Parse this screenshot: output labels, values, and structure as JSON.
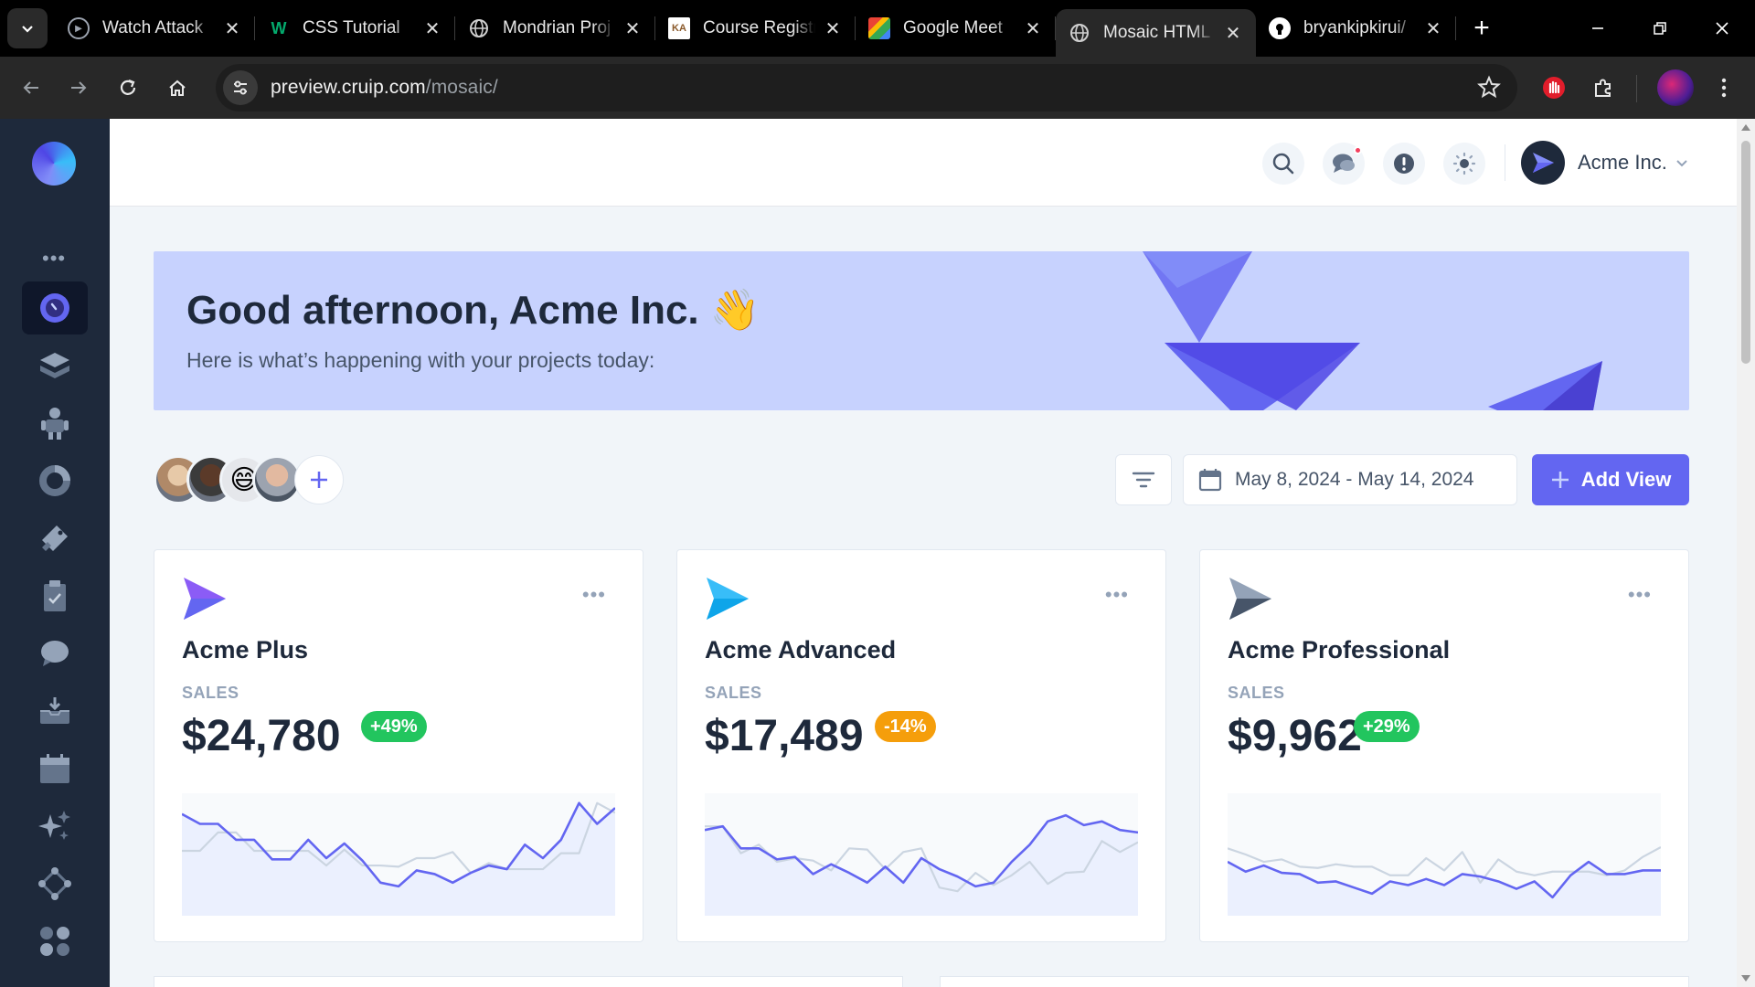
{
  "browser": {
    "tabs": [
      {
        "label": "Watch Attack",
        "icon": "play-circle-icon"
      },
      {
        "label": "CSS Tutorial",
        "icon": "w3schools-icon"
      },
      {
        "label": "Mondrian Proj",
        "icon": "globe-icon"
      },
      {
        "label": "Course Registr",
        "icon": "university-icon"
      },
      {
        "label": "Google Meet",
        "icon": "google-meet-icon"
      },
      {
        "label": "Mosaic HTML",
        "icon": "globe-icon",
        "active": true
      },
      {
        "label": "bryankipkirui/",
        "icon": "github-icon"
      }
    ],
    "url_host": "preview.cruip.com",
    "url_path": "/mosaic/"
  },
  "header": {
    "user_name": "Acme Inc."
  },
  "banner": {
    "title": "Good afternoon, Acme Inc. 👋",
    "subtitle": "Here is what’s happening with your projects today:"
  },
  "actions": {
    "date_range": "May 8, 2024 - May 14, 2024",
    "add_view_label": "Add View"
  },
  "cards": [
    {
      "title": "Acme Plus",
      "label": "SALES",
      "value": "$24,780",
      "badge": "+49%",
      "badge_color": "#22c55e",
      "logo_colors": [
        "#8b5cf6",
        "#6366f1"
      ]
    },
    {
      "title": "Acme Advanced",
      "label": "SALES",
      "value": "$17,489",
      "badge": "-14%",
      "badge_color": "#f59e0b",
      "logo_colors": [
        "#38bdf8",
        "#0ea5e9"
      ]
    },
    {
      "title": "Acme Professional",
      "label": "SALES",
      "value": "$9,962",
      "badge": "+29%",
      "badge_color": "#22c55e",
      "logo_colors": [
        "#94a3b8",
        "#475569"
      ]
    }
  ],
  "chart_data": [
    {
      "type": "line",
      "series": [
        {
          "values": [
            83,
            75,
            75,
            62,
            62,
            46,
            46,
            62,
            47,
            59,
            45,
            27,
            24,
            37,
            34,
            27,
            35,
            41,
            38,
            58,
            47,
            62,
            92,
            75,
            88
          ]
        },
        {
          "values": [
            53,
            53,
            68,
            68,
            53,
            53,
            53,
            53,
            41,
            54,
            41,
            41,
            40,
            47,
            47,
            52,
            35,
            43,
            38,
            38,
            38,
            51,
            51,
            92,
            84
          ]
        }
      ],
      "ylim": [
        0,
        100
      ]
    },
    {
      "type": "line",
      "series": [
        {
          "values": [
            70,
            73,
            55,
            55,
            46,
            48,
            34,
            42,
            35,
            27,
            40,
            27,
            47,
            38,
            32,
            24,
            27,
            44,
            58,
            77,
            82,
            74,
            77,
            70,
            68
          ]
        },
        {
          "values": [
            73,
            73,
            51,
            58,
            44,
            47,
            45,
            37,
            55,
            54,
            38,
            52,
            55,
            23,
            20,
            35,
            25,
            33,
            44,
            26,
            35,
            36,
            61,
            52,
            60
          ]
        }
      ],
      "ylim": [
        0,
        100
      ]
    },
    {
      "type": "line",
      "series": [
        {
          "values": [
            44,
            36,
            41,
            35,
            34,
            27,
            28,
            23,
            18,
            28,
            25,
            30,
            25,
            34,
            32,
            28,
            22,
            28,
            15,
            33,
            44,
            34,
            34,
            37,
            37
          ]
        },
        {
          "values": [
            55,
            50,
            44,
            46,
            40,
            39,
            42,
            40,
            40,
            33,
            33,
            47,
            37,
            52,
            27,
            46,
            36,
            33,
            36,
            36,
            36,
            33,
            37,
            48,
            56
          ]
        }
      ],
      "ylim": [
        0,
        100
      ]
    }
  ],
  "colors": {
    "accent": "#6366f1",
    "sidebar_bg": "#1e293b",
    "banner_bg": "#c7d2fe"
  }
}
